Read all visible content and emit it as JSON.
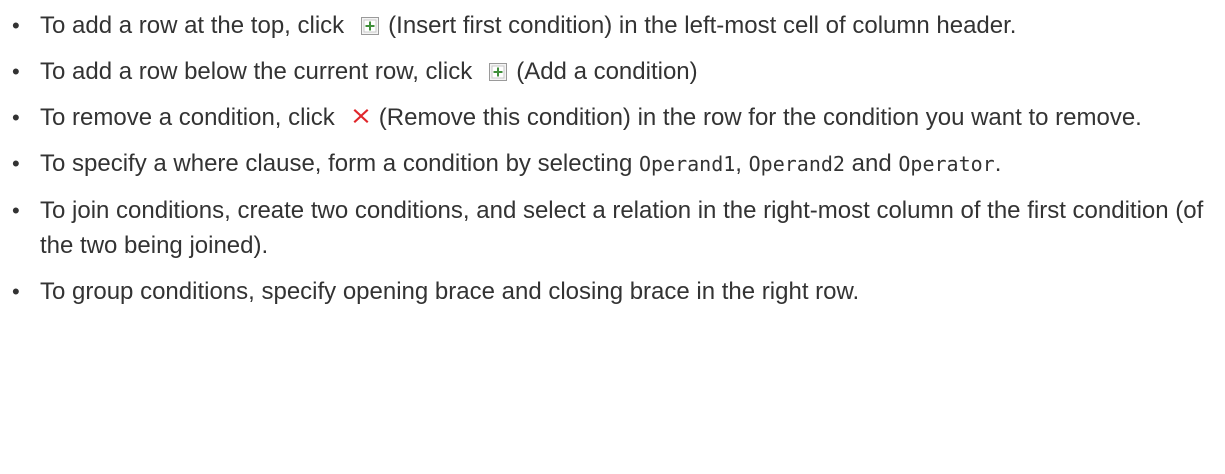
{
  "items": [
    {
      "before": "To add a row at the top, click",
      "icon": "plus-box-icon",
      "after": "(Insert first condition) in the left-most cell of column header."
    },
    {
      "before": "To add a row below the current row, click",
      "icon": "plus-box-icon",
      "after": "(Add a condition)"
    },
    {
      "before": "To remove a condition, click",
      "icon": "red-x-icon",
      "after": "(Remove this condition) in the row for the condition you want to remove."
    },
    {
      "text1": "To specify a where clause, form a condition by selecting ",
      "code1": "Operand1",
      "text2": ", ",
      "code2": "Operand2",
      "text3": " and ",
      "code3": "Operator",
      "text4": "."
    },
    {
      "text": "To join conditions, create two conditions, and select a relation in the right-most column of the first condition (of the two being joined)."
    },
    {
      "text": "To group conditions, specify opening brace and closing brace in the right row."
    }
  ],
  "colors": {
    "text": "#333333",
    "icon_green": "#3f8f3a",
    "icon_red": "#e0262b"
  }
}
